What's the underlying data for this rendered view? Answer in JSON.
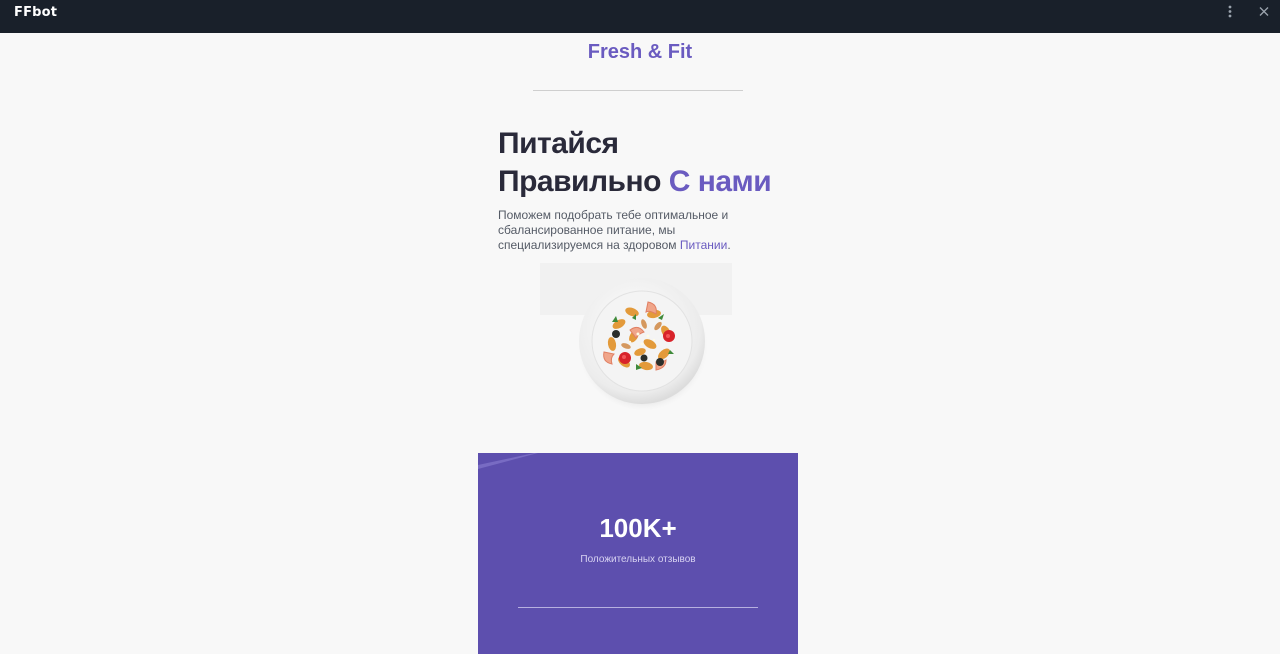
{
  "window": {
    "title": "FFbot",
    "menu_icon": "vertical-dots-icon",
    "close_icon": "close-icon"
  },
  "header": {
    "brand": "Fresh & Fit"
  },
  "hero": {
    "title_line1": "Питайся",
    "title_line2_main": "Правильно",
    "title_line2_accent": "С нами",
    "description_main": "Поможем подобрать тебе оптимальное и сбалансированное питание, мы специализируемся на здоровом",
    "description_link": "Питании",
    "description_end": "."
  },
  "stats": {
    "value": "100K+",
    "label": "Положительных отзывов"
  },
  "colors": {
    "accent": "#6a5bc0",
    "card": "#5d4fae",
    "titlebar": "#19202a",
    "background": "#f8f8f8"
  }
}
